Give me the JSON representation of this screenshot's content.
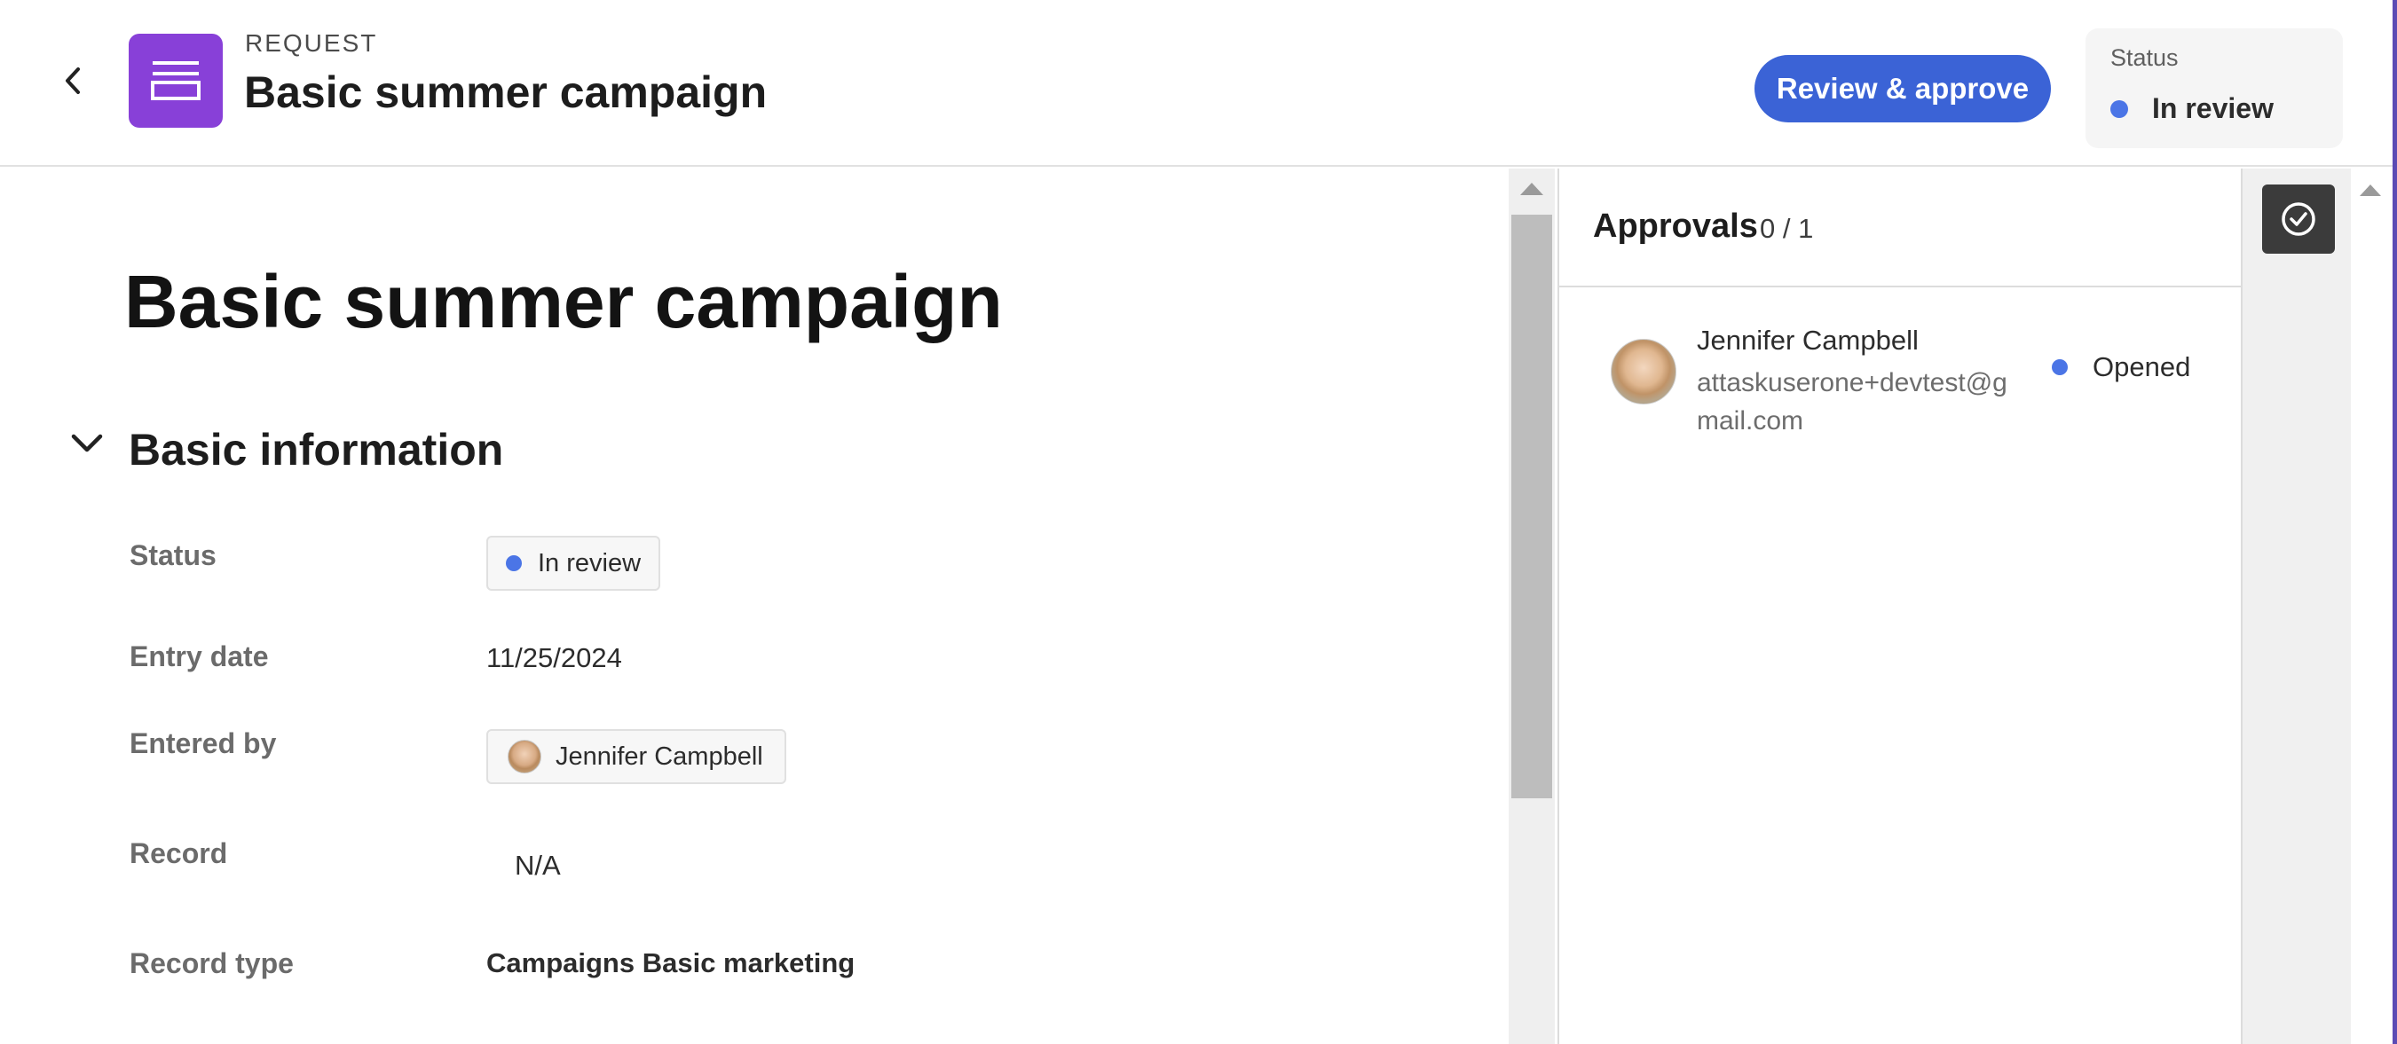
{
  "header": {
    "eyebrow": "REQUEST",
    "title": "Basic summer campaign",
    "back_icon": "chevron-left-icon",
    "app_icon": "request-form-icon",
    "app_icon_color": "#8840d8",
    "review_button_label": "Review & approve",
    "status_label": "Status",
    "status_value": "In review"
  },
  "main": {
    "page_title": "Basic summer campaign",
    "section": {
      "title": "Basic information",
      "toggle_icon": "chevron-down-icon"
    },
    "fields": [
      {
        "label": "Status",
        "value": "In review",
        "kind": "status-pill"
      },
      {
        "label": "Entry date",
        "value": "11/25/2024",
        "kind": "text"
      },
      {
        "label": "Entered by",
        "value": "Jennifer Campbell",
        "kind": "user-pill"
      },
      {
        "label": "Record",
        "value": "N/A",
        "kind": "text"
      },
      {
        "label": "Record type",
        "value": "Campaigns Basic marketing",
        "kind": "text-bold"
      }
    ]
  },
  "approvals": {
    "title": "Approvals",
    "count": "0 / 1",
    "items": [
      {
        "name": "Jennifer Campbell",
        "email": "attaskuserone+devtest@gmail.com",
        "status": "Opened"
      }
    ]
  },
  "rail": {
    "icon": "approval-check-icon"
  },
  "colors": {
    "accent": "#3b63d6",
    "status_dot": "#4b75e6",
    "app_icon": "#8840d8"
  }
}
